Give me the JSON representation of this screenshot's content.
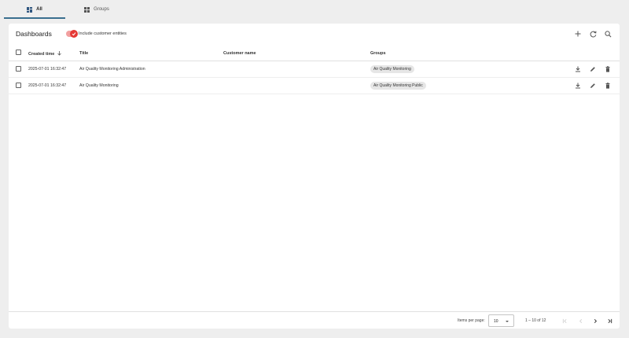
{
  "tabs": [
    {
      "label": "All",
      "icon": "dashboard-grid-icon",
      "active": true
    },
    {
      "label": "Groups",
      "icon": "groups-grid-icon",
      "active": false
    }
  ],
  "header": {
    "title": "Dashboards",
    "include_customer_label": "Include customer entities",
    "include_customer_on": true,
    "tools": [
      "add-icon",
      "refresh-icon",
      "search-icon"
    ]
  },
  "table": {
    "columns": [
      "Created time",
      "Title",
      "Customer name",
      "Groups"
    ],
    "sort_column": "Created time",
    "rows": [
      {
        "created": "2025-07-01 16:32:47",
        "title": "Air Quality Monitoring Administration",
        "customer": "",
        "group": "Air Quality Monitoring"
      },
      {
        "created": "2025-07-01 16:32:47",
        "title": "Air Quality Monitoring",
        "customer": "",
        "group": "Air Quality Monitoring Public"
      }
    ]
  },
  "footer": {
    "items_per_page_label": "Items per page:",
    "items_per_page": "10",
    "range": "1 – 10 of 12"
  },
  "colors": {
    "accent": "#e53935",
    "tab_underline": "#3a6f8f"
  }
}
